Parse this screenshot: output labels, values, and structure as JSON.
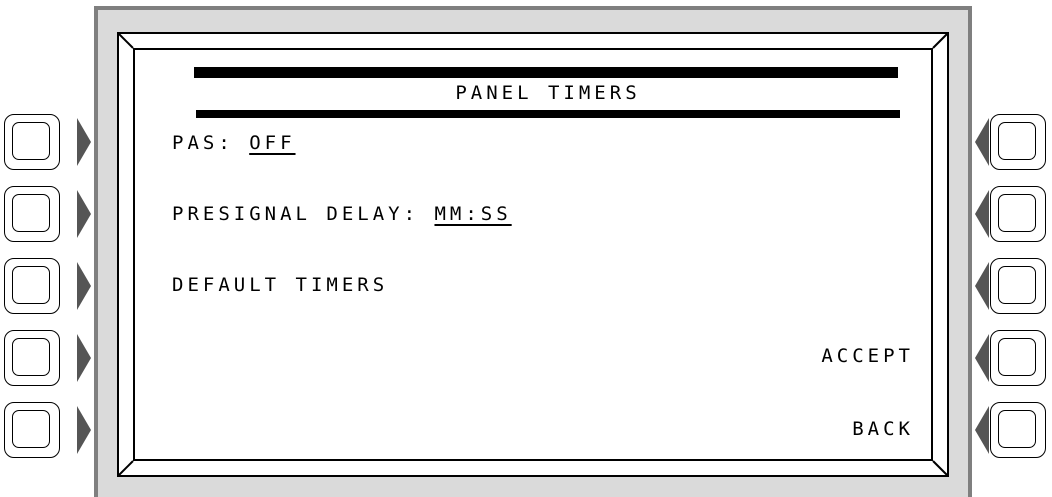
{
  "screen": {
    "title": "PANEL TIMERS",
    "items": [
      {
        "label": "PAS: ",
        "value": "OFF"
      },
      {
        "label": "PRESIGNAL DELAY: ",
        "value": "MM:SS"
      },
      {
        "label": "DEFAULT TIMERS"
      }
    ],
    "actions": {
      "accept": "ACCEPT",
      "back": "BACK"
    }
  },
  "colors": {
    "bezel": "#dadada",
    "bezel_border": "#7f7f7f",
    "text": "#000000",
    "screen": "#ffffff"
  }
}
